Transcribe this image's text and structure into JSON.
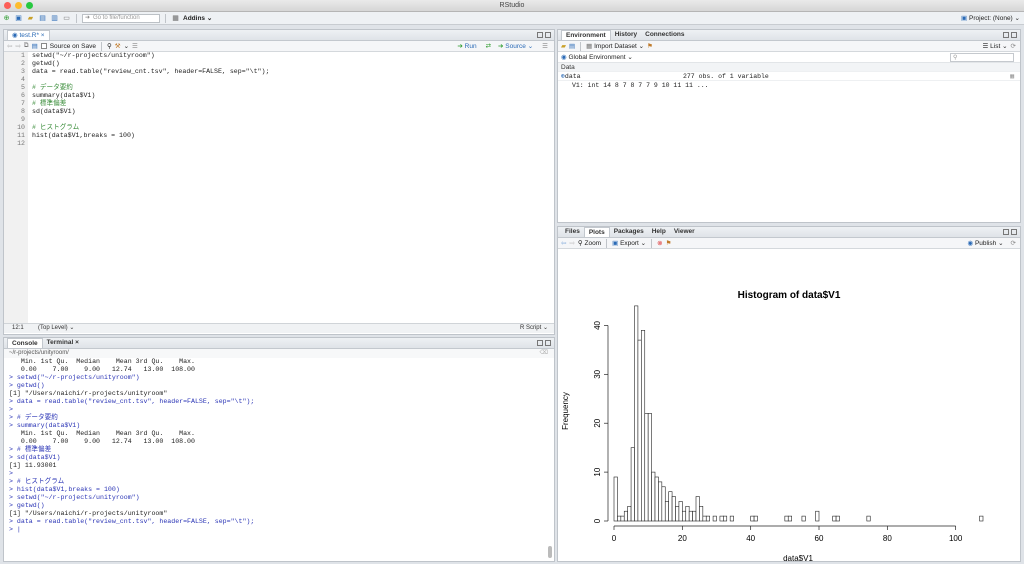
{
  "window": {
    "title": "RStudio"
  },
  "toolbar": {
    "goto_placeholder": "Go to file/function",
    "addins": "Addins",
    "project": "Project: (None)"
  },
  "colors": {
    "close": "#fc5f57",
    "minimize": "#fdbc2e",
    "zoom": "#28c840",
    "accent": "#2a6ab6",
    "comment": "#3a8d3a"
  },
  "editor": {
    "tab": "test.R*",
    "source_on_save": "Source on Save",
    "run": "Run",
    "source": "Source",
    "line_numbers": [
      "1",
      "2",
      "3",
      "4",
      "5",
      "6",
      "7",
      "8",
      "9",
      "10",
      "11",
      "12"
    ],
    "lines": [
      "setwd(\"~/r-projects/unityroom\")",
      "getwd()",
      "data = read.table(\"review_cnt.tsv\", header=FALSE, sep=\"\\t\");",
      "",
      "# データ要約",
      "summary(data$V1)",
      "# 標準偏差",
      "sd(data$V1)",
      "",
      "# ヒストグラム",
      "hist(data$V1,breaks = 100)",
      ""
    ],
    "status_pos": "12:1",
    "status_scope": "(Top Level) ⌄",
    "status_lang": "R Script ⌄"
  },
  "console": {
    "tabs": [
      "Console",
      "Terminal ×"
    ],
    "path": "~/r-projects/unityroom/",
    "lines": [
      {
        "t": "   Min. 1st Qu.  Median    Mean 3rd Qu.    Max. ",
        "in": false
      },
      {
        "t": "   0.00    7.00    9.00   12.74   13.00  108.00 ",
        "in": false
      },
      {
        "t": "> setwd(\"~/r-projects/unityroom\")",
        "in": true
      },
      {
        "t": "> getwd()",
        "in": true
      },
      {
        "t": "[1] \"/Users/naichi/r-projects/unityroom\"",
        "in": false
      },
      {
        "t": "> data = read.table(\"review_cnt.tsv\", header=FALSE, sep=\"\\t\");",
        "in": true
      },
      {
        "t": ">",
        "in": true
      },
      {
        "t": "> # データ要約",
        "in": true
      },
      {
        "t": "> summary(data$V1)",
        "in": true
      },
      {
        "t": "   Min. 1st Qu.  Median    Mean 3rd Qu.    Max. ",
        "in": false
      },
      {
        "t": "   0.00    7.00    9.00   12.74   13.00  108.00 ",
        "in": false
      },
      {
        "t": "> # 標準偏差",
        "in": true
      },
      {
        "t": "> sd(data$V1)",
        "in": true
      },
      {
        "t": "[1] 11.93001",
        "in": false
      },
      {
        "t": ">",
        "in": true
      },
      {
        "t": "> # ヒストグラム",
        "in": true
      },
      {
        "t": "> hist(data$V1,breaks = 100)",
        "in": true
      },
      {
        "t": "> setwd(\"~/r-projects/unityroom\")",
        "in": true
      },
      {
        "t": "> getwd()",
        "in": true
      },
      {
        "t": "[1] \"/Users/naichi/r-projects/unityroom\"",
        "in": false
      },
      {
        "t": "> data = read.table(\"review_cnt.tsv\", header=FALSE, sep=\"\\t\");",
        "in": true
      },
      {
        "t": "> |",
        "in": true
      }
    ]
  },
  "environment": {
    "tabs": [
      "Environment",
      "History",
      "Connections"
    ],
    "import": "Import Dataset",
    "list": "List",
    "global": "Global Environment",
    "section": "Data",
    "var_name": "data",
    "var_desc": "277 obs. of 1 variable",
    "var_detail": "V1: int 14 8 7 8 7 7 9 10 11 11 ..."
  },
  "files": {
    "tabs": [
      "Files",
      "Plots",
      "Packages",
      "Help",
      "Viewer"
    ],
    "zoom": "Zoom",
    "export": "Export",
    "publish": "Publish"
  },
  "chart_data": {
    "type": "bar",
    "title": "Histogram of data$V1",
    "xlabel": "data$V1",
    "ylabel": "Frequency",
    "xlim": [
      0,
      108
    ],
    "ylim": [
      0,
      45
    ],
    "xticks": [
      0,
      20,
      40,
      60,
      80,
      100
    ],
    "yticks": [
      0,
      10,
      20,
      30,
      40
    ],
    "bin_width": 1,
    "bins": [
      [
        0,
        9
      ],
      [
        1,
        1
      ],
      [
        2,
        1
      ],
      [
        3,
        2
      ],
      [
        4,
        3
      ],
      [
        5,
        15
      ],
      [
        6,
        44
      ],
      [
        7,
        37
      ],
      [
        8,
        39
      ],
      [
        9,
        22
      ],
      [
        10,
        22
      ],
      [
        11,
        10
      ],
      [
        12,
        9
      ],
      [
        13,
        8
      ],
      [
        14,
        7
      ],
      [
        15,
        4
      ],
      [
        16,
        6
      ],
      [
        17,
        5
      ],
      [
        18,
        3
      ],
      [
        19,
        4
      ],
      [
        20,
        2
      ],
      [
        21,
        3
      ],
      [
        22,
        2
      ],
      [
        23,
        2
      ],
      [
        24,
        5
      ],
      [
        25,
        3
      ],
      [
        26,
        1
      ],
      [
        27,
        1
      ],
      [
        29,
        1
      ],
      [
        31,
        1
      ],
      [
        32,
        1
      ],
      [
        34,
        1
      ],
      [
        40,
        1
      ],
      [
        41,
        1
      ],
      [
        50,
        1
      ],
      [
        51,
        1
      ],
      [
        55,
        1
      ],
      [
        59,
        2
      ],
      [
        64,
        1
      ],
      [
        65,
        1
      ],
      [
        74,
        1
      ],
      [
        107,
        1
      ]
    ]
  }
}
